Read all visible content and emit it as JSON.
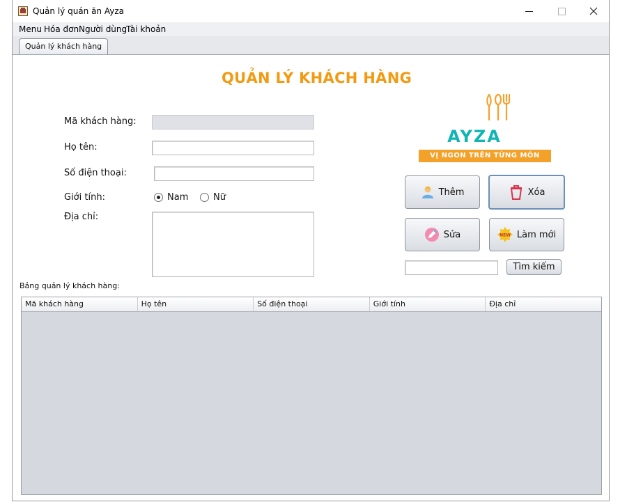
{
  "window": {
    "title": "Quản lý quán ăn Ayza",
    "minimize": "─",
    "maximize": "☐",
    "close": "✕"
  },
  "menu": [
    "Menu",
    "Hóa đơn",
    "Người dùng",
    "Tài khoản"
  ],
  "tab": "Quản lý khách hàng",
  "heading": "QUẢN LÝ KHÁCH HÀNG",
  "form": {
    "customer_id_label": "Mã khách hàng:",
    "customer_id_value": "",
    "name_label": "Họ tên:",
    "name_value": "",
    "phone_label": "Số điện thoại:",
    "phone_value": "",
    "gender_label": "Giới tính:",
    "gender_options": [
      "Nam",
      "Nữ"
    ],
    "gender_selected": "Nam",
    "address_label": "Địa chỉ:",
    "address_value": ""
  },
  "logo": {
    "name": "AYZA",
    "tagline": "VỊ NGON TRÊN TỪNG MÓN"
  },
  "buttons": {
    "add": "Thêm",
    "delete": "Xóa",
    "edit": "Sửa",
    "refresh": "Làm mới",
    "search": "Tìm kiếm",
    "search_value": ""
  },
  "table": {
    "caption": "Bảng quản lý khách hàng:",
    "columns": [
      "Mã khách hàng",
      "Họ tên",
      "Số điện thoại",
      "Giới tính",
      "Địa chỉ"
    ],
    "rows": []
  },
  "colors": {
    "heading": "#f29a12",
    "logo_teal": "#12b4b4",
    "logo_banner": "#f4a12a"
  }
}
